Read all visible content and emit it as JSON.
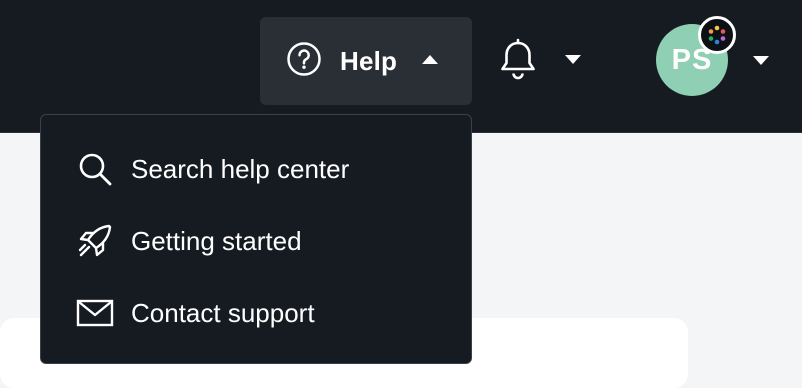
{
  "topbar": {
    "help_button": {
      "label": "Help",
      "icon": "question-circle-icon",
      "caret": "caret-up-icon"
    },
    "notifications": {
      "icon": "bell-icon",
      "caret": "caret-down-icon"
    },
    "user": {
      "initials": "PS",
      "avatar_color": "#8fcfb4",
      "badge_icon": "color-dots-icon",
      "caret": "caret-down-icon"
    }
  },
  "help_menu": {
    "items": [
      {
        "label": "Search help center",
        "icon": "search-icon"
      },
      {
        "label": "Getting started",
        "icon": "rocket-icon"
      },
      {
        "label": "Contact support",
        "icon": "envelope-icon"
      }
    ]
  },
  "colors": {
    "topbar_bg": "#161b22",
    "menu_bg": "#161b22",
    "page_bg": "#f4f5f7",
    "text": "#ffffff"
  }
}
